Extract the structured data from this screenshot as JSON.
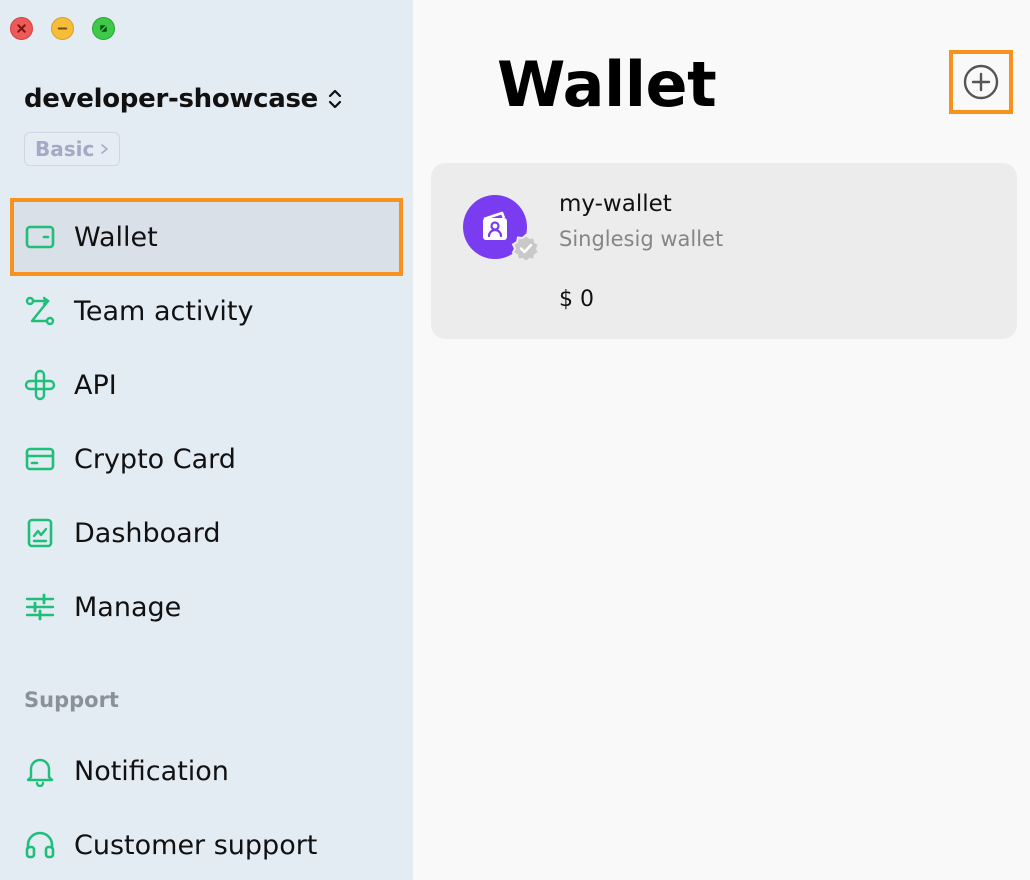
{
  "window": {
    "controls": [
      "close",
      "minimize",
      "maximize"
    ]
  },
  "sidebar": {
    "org_name": "developer-showcase",
    "plan": "Basic",
    "items": [
      {
        "label": "Wallet",
        "icon": "wallet-icon",
        "active": true
      },
      {
        "label": "Team activity",
        "icon": "team-activity-icon"
      },
      {
        "label": "API",
        "icon": "api-icon"
      },
      {
        "label": "Crypto Card",
        "icon": "credit-card-icon"
      },
      {
        "label": "Dashboard",
        "icon": "dashboard-icon"
      },
      {
        "label": "Manage",
        "icon": "sliders-icon"
      }
    ],
    "support_label": "Support",
    "support_items": [
      {
        "label": "Notification",
        "icon": "bell-icon"
      },
      {
        "label": "Customer support",
        "icon": "headphones-icon"
      }
    ]
  },
  "main": {
    "title": "Wallet",
    "add_icon": "plus-circle-icon",
    "wallets": [
      {
        "name": "my-wallet",
        "type": "Singlesig wallet",
        "balance": "$ 0",
        "verified": true
      }
    ]
  },
  "colors": {
    "accent_green": "#1fbf7a",
    "highlight_orange": "#f7921e",
    "wallet_purple": "#7a3cf0",
    "sidebar_bg": "#e3ebf3"
  }
}
